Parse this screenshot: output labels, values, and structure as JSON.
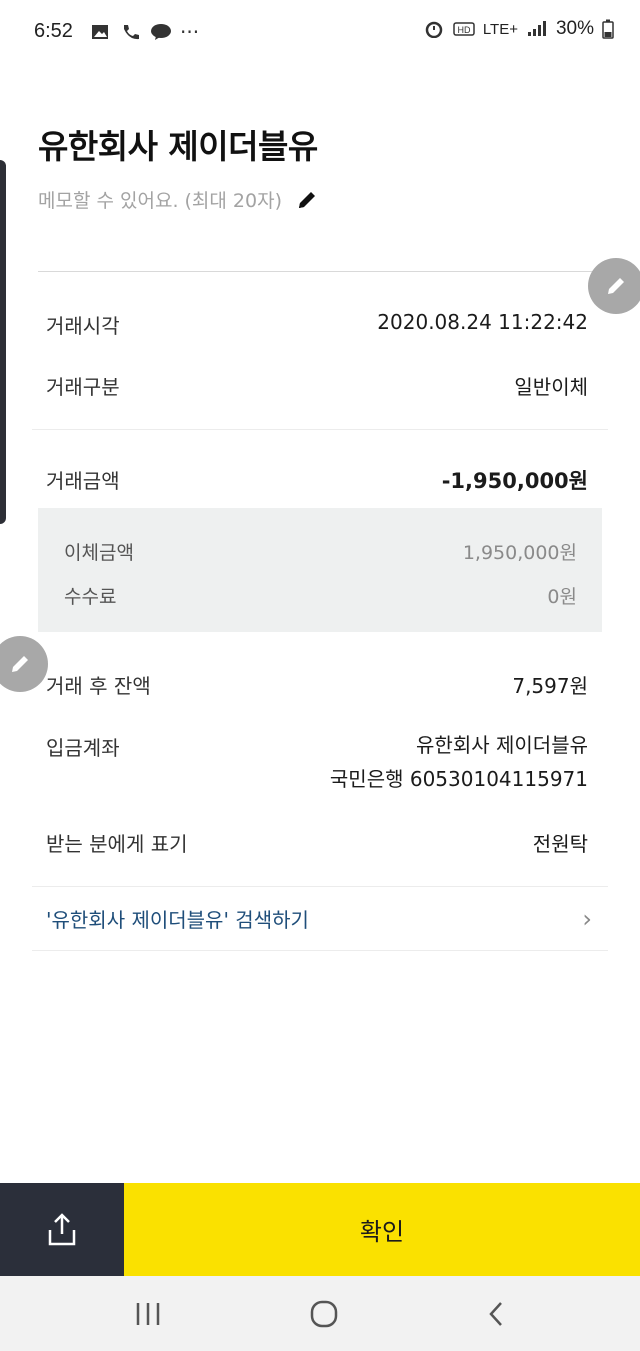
{
  "status_bar": {
    "time": "6:52",
    "more": "···",
    "network": "LTE+",
    "battery": "30%"
  },
  "header": {
    "title": "유한회사 제이더블유",
    "memo_placeholder": "메모할 수 있어요. (최대 20자)"
  },
  "details": {
    "time_label": "거래시각",
    "time_value": "2020.08.24 11:22:42",
    "type_label": "거래구분",
    "type_value": "일반이체",
    "amount_label": "거래금액",
    "amount_value": "-1,950,000원",
    "transfer_label": "이체금액",
    "transfer_value": "1,950,000원",
    "fee_label": "수수료",
    "fee_value": "0원",
    "balance_label": "거래 후 잔액",
    "balance_value": "7,597원",
    "account_label": "입금계좌",
    "account_name": "유한회사 제이더블유",
    "account_number": "국민은행 60530104115971",
    "display_label": "받는 분에게 표기",
    "display_value": "전원탁"
  },
  "search_link": {
    "label": "'유한회사 제이더블유' 검색하기",
    "chevron": "›"
  },
  "bottom": {
    "confirm_label": "확인"
  },
  "colors": {
    "confirm_yellow": "#fae100",
    "share_dark": "#2b2f3a",
    "link_blue": "#1f4e7a"
  },
  "icons": [
    "gallery-icon",
    "phone-icon",
    "talk-icon",
    "alarm-icon",
    "hd-icon",
    "signal-icon",
    "battery-icon",
    "pencil-icon",
    "share-icon",
    "recents-icon",
    "home-icon",
    "back-icon"
  ]
}
